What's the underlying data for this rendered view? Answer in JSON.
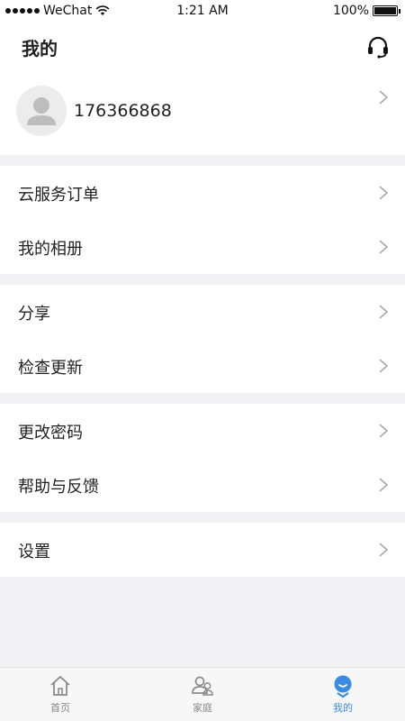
{
  "status_bar": {
    "carrier": "WeChat",
    "time": "1:21 AM",
    "battery": "100%"
  },
  "header": {
    "title": "我的",
    "support_icon": "headset-icon"
  },
  "profile": {
    "phone": "176366868",
    "avatar_icon": "user-avatar-icon"
  },
  "menu": [
    {
      "section": 1,
      "items": [
        "云服务订单",
        "我的相册"
      ]
    },
    {
      "section": 2,
      "items": [
        "分享",
        "检查更新"
      ]
    },
    {
      "section": 3,
      "items": [
        "更改密码",
        "帮助与反馈"
      ]
    },
    {
      "section": 4,
      "items": [
        "设置"
      ]
    }
  ],
  "tabbar": {
    "tabs": [
      {
        "label": "首页",
        "icon": "home-icon"
      },
      {
        "label": "家庭",
        "icon": "family-icon"
      },
      {
        "label": "我的",
        "icon": "me-icon"
      }
    ],
    "active": "我的",
    "active_color": "#3b8be0"
  }
}
